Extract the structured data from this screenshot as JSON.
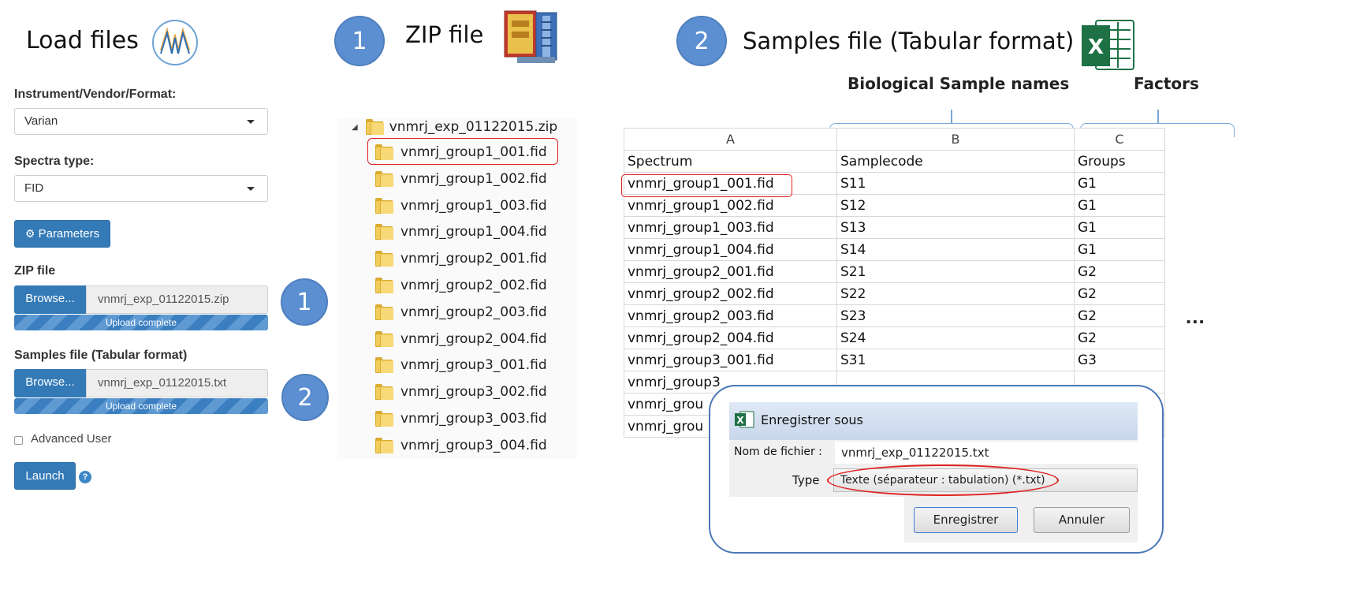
{
  "load_files": {
    "title": "Load files"
  },
  "panel": {
    "instrument_label": "Instrument/Vendor/Format:",
    "instrument_value": "Varian",
    "spectra_label": "Spectra type:",
    "spectra_value": "FID",
    "parameters_button": "Parameters",
    "zip_label": "ZIP file",
    "zip_browse": "Browse...",
    "zip_filename": "vnmrj_exp_01122015.zip",
    "zip_progress": "Upload complete",
    "samples_label": "Samples file (Tabular format)",
    "samples_browse": "Browse...",
    "samples_filename": "vnmrj_exp_01122015.txt",
    "samples_progress": "Upload complete",
    "advanced_user": "Advanced User",
    "launch_button": "Launch",
    "help_icon": "?"
  },
  "steps": {
    "one": "1",
    "two": "2",
    "zip_title": "ZIP file",
    "samples_title": "Samples file (Tabular format)"
  },
  "tree": {
    "root": "vnmrj_exp_01122015.zip",
    "items": [
      "vnmrj_group1_001.fid",
      "vnmrj_group1_002.fid",
      "vnmrj_group1_003.fid",
      "vnmrj_group1_004.fid",
      "vnmrj_group2_001.fid",
      "vnmrj_group2_002.fid",
      "vnmrj_group2_003.fid",
      "vnmrj_group2_004.fid",
      "vnmrj_group3_001.fid",
      "vnmrj_group3_002.fid",
      "vnmrj_group3_003.fid",
      "vnmrj_group3_004.fid"
    ]
  },
  "sheet": {
    "bio_names_label": "Biological Sample names",
    "factors_label": "Factors",
    "col_letters": [
      "A",
      "B",
      "C"
    ],
    "headers": [
      "Spectrum",
      "Samplecode",
      "Groups"
    ],
    "rows": [
      [
        "vnmrj_group1_001.fid",
        "S11",
        "G1"
      ],
      [
        "vnmrj_group1_002.fid",
        "S12",
        "G1"
      ],
      [
        "vnmrj_group1_003.fid",
        "S13",
        "G1"
      ],
      [
        "vnmrj_group1_004.fid",
        "S14",
        "G1"
      ],
      [
        "vnmrj_group2_001.fid",
        "S21",
        "G2"
      ],
      [
        "vnmrj_group2_002.fid",
        "S22",
        "G2"
      ],
      [
        "vnmrj_group2_003.fid",
        "S23",
        "G2"
      ],
      [
        "vnmrj_group2_004.fid",
        "S24",
        "G2"
      ],
      [
        "vnmrj_group3_001.fid",
        "S31",
        "G3"
      ],
      [
        "vnmrj_group3",
        "",
        ""
      ],
      [
        "vnmrj_grou",
        "",
        ""
      ],
      [
        "vnmrj_grou",
        "",
        ""
      ]
    ],
    "ellipsis": "..."
  },
  "dialog": {
    "title": "Enregistrer sous",
    "filename_label": "Nom de fichier :",
    "filename_value": "vnmrj_exp_01122015.txt",
    "type_label": "Type",
    "type_value": "Texte (séparateur : tabulation) (*.txt)",
    "save_button": "Enregistrer",
    "cancel_button": "Annuler"
  },
  "icons": {
    "excel_letter": "X",
    "excel_small_letter": "X"
  },
  "colors": {
    "step_circle": "#5b8fd1",
    "primary_button": "#337ab7",
    "highlight_red": "#e02020",
    "excel_green": "#1e7145"
  }
}
